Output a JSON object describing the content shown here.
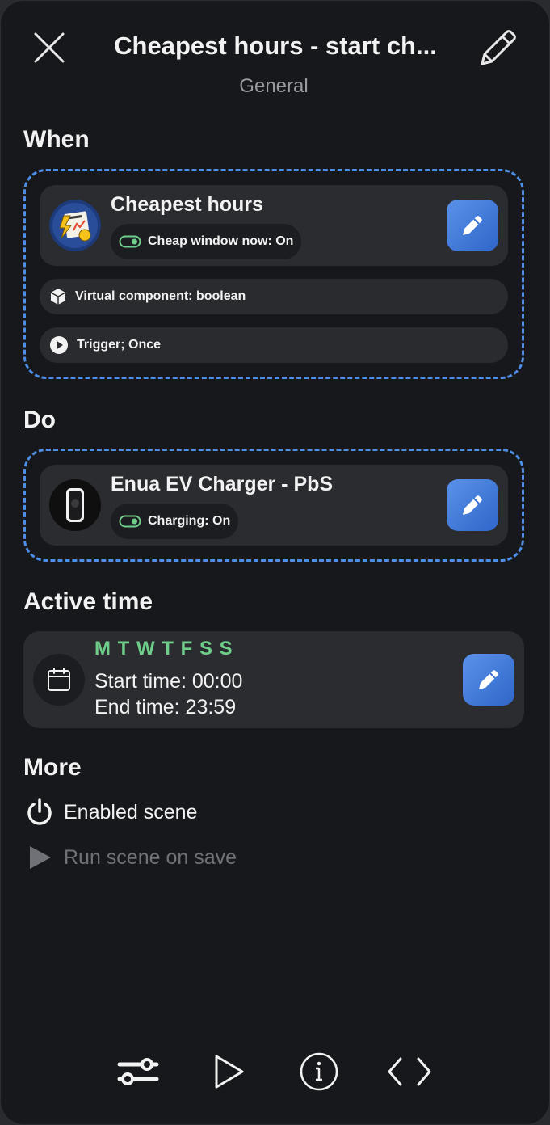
{
  "header": {
    "title": "Cheapest hours - start ch...",
    "subtitle": "General"
  },
  "sections": {
    "when": "When",
    "do": "Do",
    "active_time": "Active time",
    "more": "More"
  },
  "when": {
    "card": {
      "title": "Cheapest hours",
      "status": "Cheap window now: On",
      "avatar": "cheapest-hours-logo"
    },
    "component": "Virtual component: boolean",
    "trigger": "Trigger; Once"
  },
  "do": {
    "card": {
      "title": "Enua EV Charger - PbS",
      "status": "Charging: On",
      "avatar": "ev-charger-device"
    }
  },
  "active_time": {
    "days": "M T W T F S S",
    "start": "Start time: 00:00",
    "end": "End time: 23:59"
  },
  "more": {
    "enabled": "Enabled scene",
    "run_on_save": "Run scene on save"
  },
  "colors": {
    "background": "#17181b",
    "card": "#2b2c30",
    "accent_blue": "#4d8ee6",
    "days_green": "#6fcf8a",
    "muted": "#9a9ba0"
  },
  "icons": {
    "close": "close-icon",
    "edit_title": "pencil-outline-icon",
    "edit": "pencil-icon",
    "toggle": "toggle-on-icon",
    "cube": "cube-icon",
    "play_circle": "play-circle-icon",
    "calendar": "calendar-icon",
    "power": "power-icon",
    "play": "play-icon",
    "settings": "sliders-icon",
    "run": "play-outline-icon",
    "info": "info-icon",
    "code": "code-icon"
  }
}
